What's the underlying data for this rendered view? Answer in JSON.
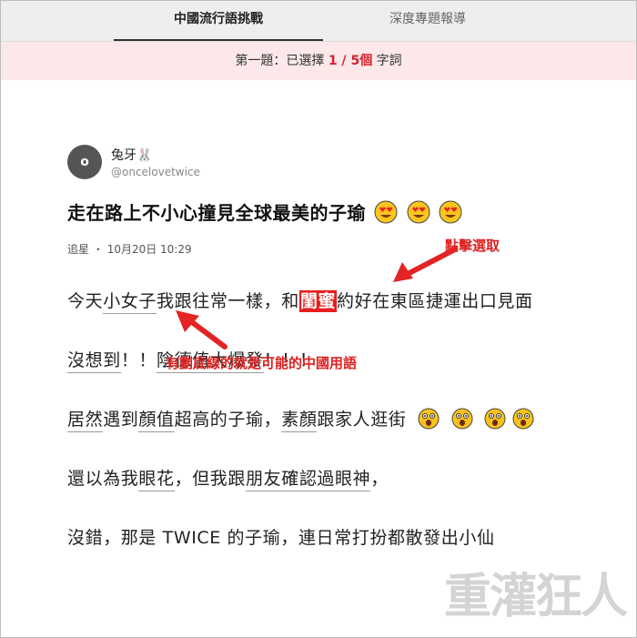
{
  "tabs": [
    {
      "label": "中國流行語挑戰"
    },
    {
      "label": "深度專題報導"
    }
  ],
  "status": {
    "prefix": "第一題：已選擇 ",
    "selected": "1",
    "separator": " / ",
    "total": "5",
    "unit": "個",
    "suffix": " 字詞"
  },
  "post": {
    "avatar_letter": "o",
    "user_name": "兔牙🐰",
    "handle": "@oncelovetwice",
    "title": "走在路上不小心撞見全球最美的子瑜",
    "category": "追星",
    "dot": "・",
    "date": "10月20日 10:29"
  },
  "body": {
    "p1": {
      "a": "今天",
      "u1": "小女子",
      "b": "我跟往常一樣，和",
      "selected": "閨蜜",
      "c": "約好在東區捷運出口見面"
    },
    "p2": {
      "u1": "沒想到",
      "a": "！！",
      "u2": "陰德值",
      "u3": "大爆發",
      "b": "！！！"
    },
    "p3": {
      "u1": "居然",
      "a": "遇到",
      "u2": "顏值",
      "b": "超高的子瑜，",
      "u3": "素顏",
      "c": "跟家人逛街"
    },
    "p4": {
      "a": "還以為我",
      "u1": "眼花",
      "b": "，但我跟",
      "u2": "朋友",
      "u3": "確認過眼神",
      "c": "，"
    },
    "p5": {
      "a": "沒錯，那是 TWICE 的子瑜，連日常打扮都散發出小仙"
    }
  },
  "annotations": {
    "click_select": "點擊選取",
    "underline_hint": "有劃底線的就是可能的中國用語"
  },
  "watermark": {
    "text": "重灌狂人"
  },
  "colors": {
    "accent": "#e81d1d",
    "status_bg": "#fce8e8",
    "tabbar_bg": "#eeeeee"
  }
}
